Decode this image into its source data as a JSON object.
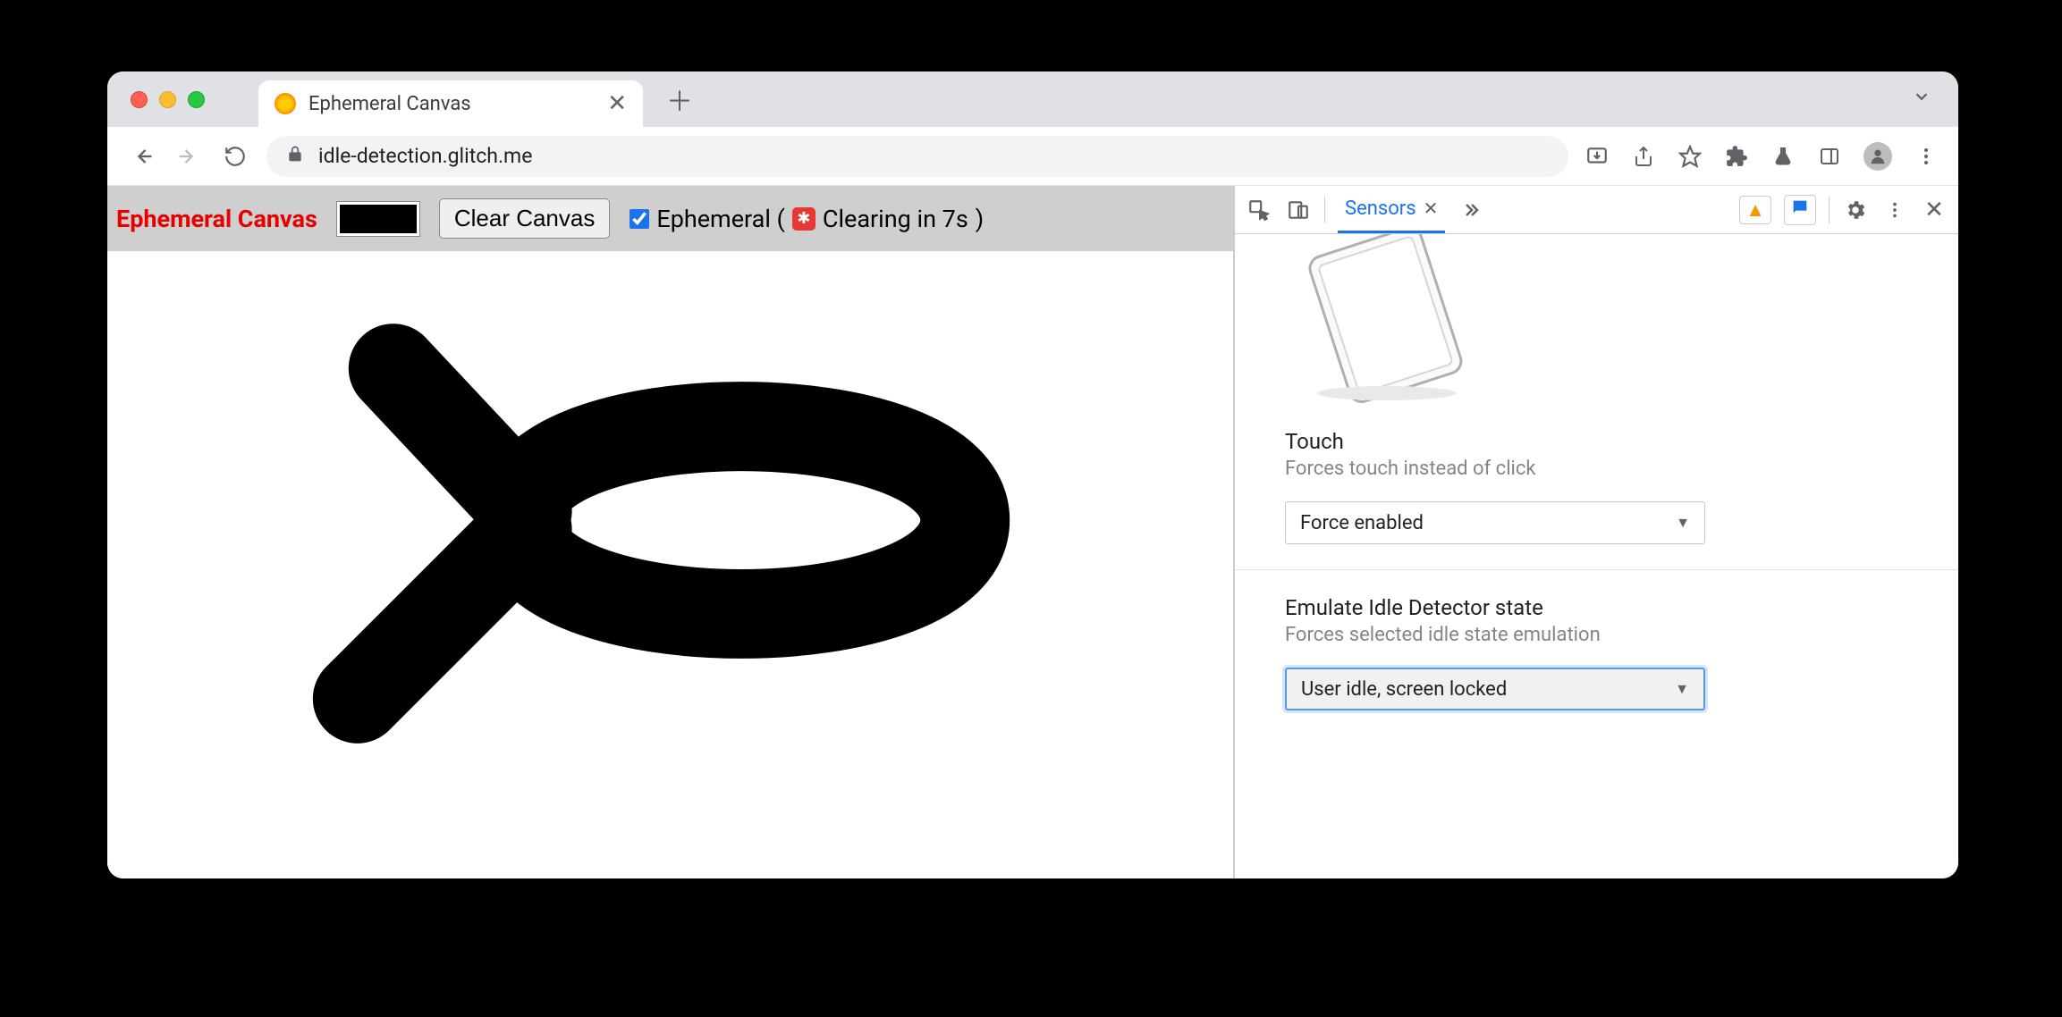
{
  "browser": {
    "tab_title": "Ephemeral Canvas",
    "url": "idle-detection.glitch.me"
  },
  "page": {
    "title": "Ephemeral Canvas",
    "clear_button_label": "Clear Canvas",
    "ephemeral_label_prefix": "Ephemeral (",
    "ephemeral_countdown": "Clearing in 7s",
    "ephemeral_label_suffix": ")",
    "ephemeral_checked": true,
    "color_value": "#000000"
  },
  "devtools": {
    "tabs": {
      "sensors": "Sensors"
    },
    "sections": {
      "touch": {
        "title": "Touch",
        "subtitle": "Forces touch instead of click",
        "value": "Force enabled"
      },
      "idle": {
        "title": "Emulate Idle Detector state",
        "subtitle": "Forces selected idle state emulation",
        "value": "User idle, screen locked"
      }
    }
  }
}
